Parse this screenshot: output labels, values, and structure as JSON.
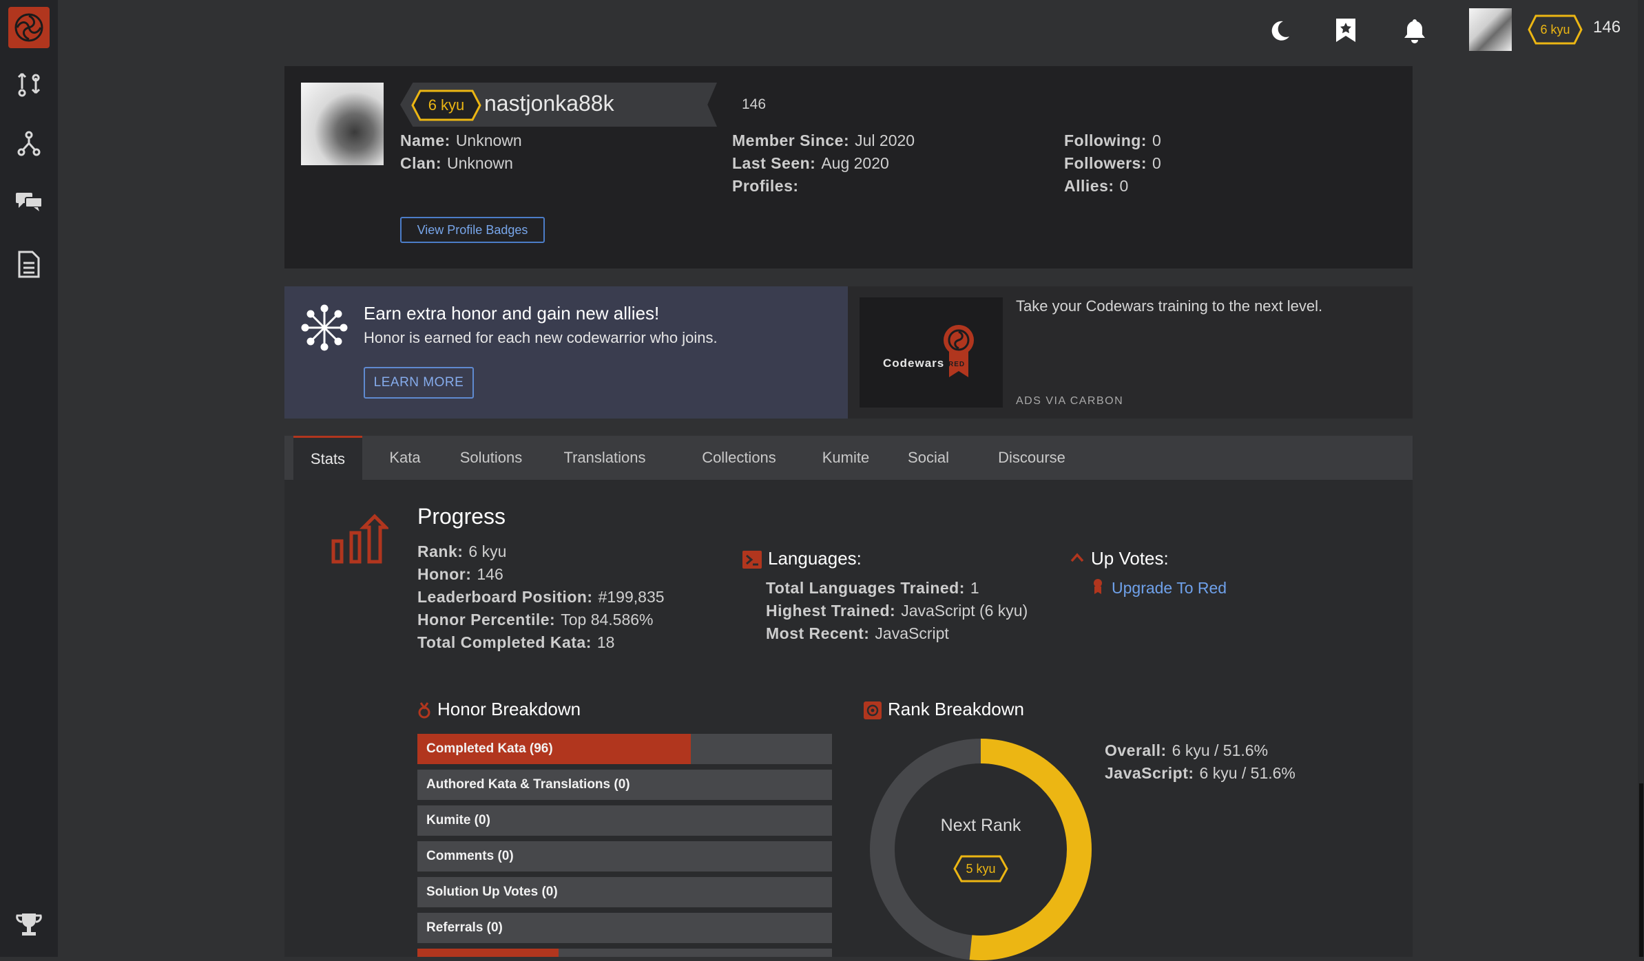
{
  "topbar": {
    "rank": "6 kyu",
    "honor": "146",
    "icons": [
      "moon-icon",
      "bookmark-icon",
      "bell-icon"
    ]
  },
  "sidebar": {
    "icons": [
      "codewars-logo-icon",
      "practice-icon",
      "kumite-icon",
      "discuss-icon",
      "docs-icon",
      "leaderboard-trophy-icon"
    ]
  },
  "profile": {
    "rank": "6 kyu",
    "username": "nastjonka88k",
    "honor": "146",
    "col1": [
      {
        "k": "Name:",
        "v": "Unknown"
      },
      {
        "k": "Clan:",
        "v": "Unknown"
      }
    ],
    "col2": [
      {
        "k": "Member Since:",
        "v": "Jul 2020"
      },
      {
        "k": "Last Seen:",
        "v": "Aug 2020"
      },
      {
        "k": "Profiles:",
        "v": ""
      }
    ],
    "col3": [
      {
        "k": "Following:",
        "v": "0"
      },
      {
        "k": "Followers:",
        "v": "0"
      },
      {
        "k": "Allies:",
        "v": "0"
      }
    ],
    "badges_button": "View Profile Badges"
  },
  "promo": {
    "title": "Earn extra honor and gain new allies!",
    "subtitle": "Honor is earned for each new codewarrior who joins.",
    "button": "LEARN MORE"
  },
  "ad": {
    "brand": "Codewars",
    "brand_tag": "RED",
    "text": "Take your Codewars training to the next level.",
    "via": "ADS VIA CARBON"
  },
  "tabs": [
    "Stats",
    "Kata",
    "Solutions",
    "Translations",
    "Collections",
    "Kumite",
    "Social",
    "Discourse"
  ],
  "progress": {
    "title": "Progress",
    "items": [
      {
        "k": "Rank:",
        "v": "6 kyu"
      },
      {
        "k": "Honor:",
        "v": "146"
      },
      {
        "k": "Leaderboard Position:",
        "v": "#199,835"
      },
      {
        "k": "Honor Percentile:",
        "v": "Top 84.586%"
      },
      {
        "k": "Total Completed Kata:",
        "v": "18"
      }
    ]
  },
  "languages": {
    "title": "Languages:",
    "items": [
      {
        "k": "Total Languages Trained:",
        "v": "1"
      },
      {
        "k": "Highest Trained:",
        "v": "JavaScript (6 kyu)"
      },
      {
        "k": "Most Recent:",
        "v": "JavaScript"
      }
    ]
  },
  "upvotes": {
    "title": "Up Votes:",
    "link": "Upgrade To Red"
  },
  "honor_breakdown": {
    "title": "Honor Breakdown",
    "rows": [
      {
        "label": "Completed Kata (96)",
        "fill": 0.66
      },
      {
        "label": "Authored Kata & Translations (0)",
        "fill": 0
      },
      {
        "label": "Kumite (0)",
        "fill": 0
      },
      {
        "label": "Comments (0)",
        "fill": 0
      },
      {
        "label": "Solution Up Votes (0)",
        "fill": 0
      },
      {
        "label": "Referrals (0)",
        "fill": 0
      }
    ],
    "partial_row_fill": 0.34
  },
  "rank_breakdown": {
    "title": "Rank Breakdown",
    "items": [
      {
        "k": "Overall:",
        "v": "6 kyu / 51.6%"
      },
      {
        "k": "JavaScript:",
        "v": "6 kyu / 51.6%"
      }
    ],
    "next_rank_label": "Next Rank",
    "next_rank": "5 kyu",
    "progress": 0.516
  },
  "colors": {
    "accent": "#b1361e",
    "rank_yellow": "#ecb613",
    "link": "#6fa1ea"
  }
}
